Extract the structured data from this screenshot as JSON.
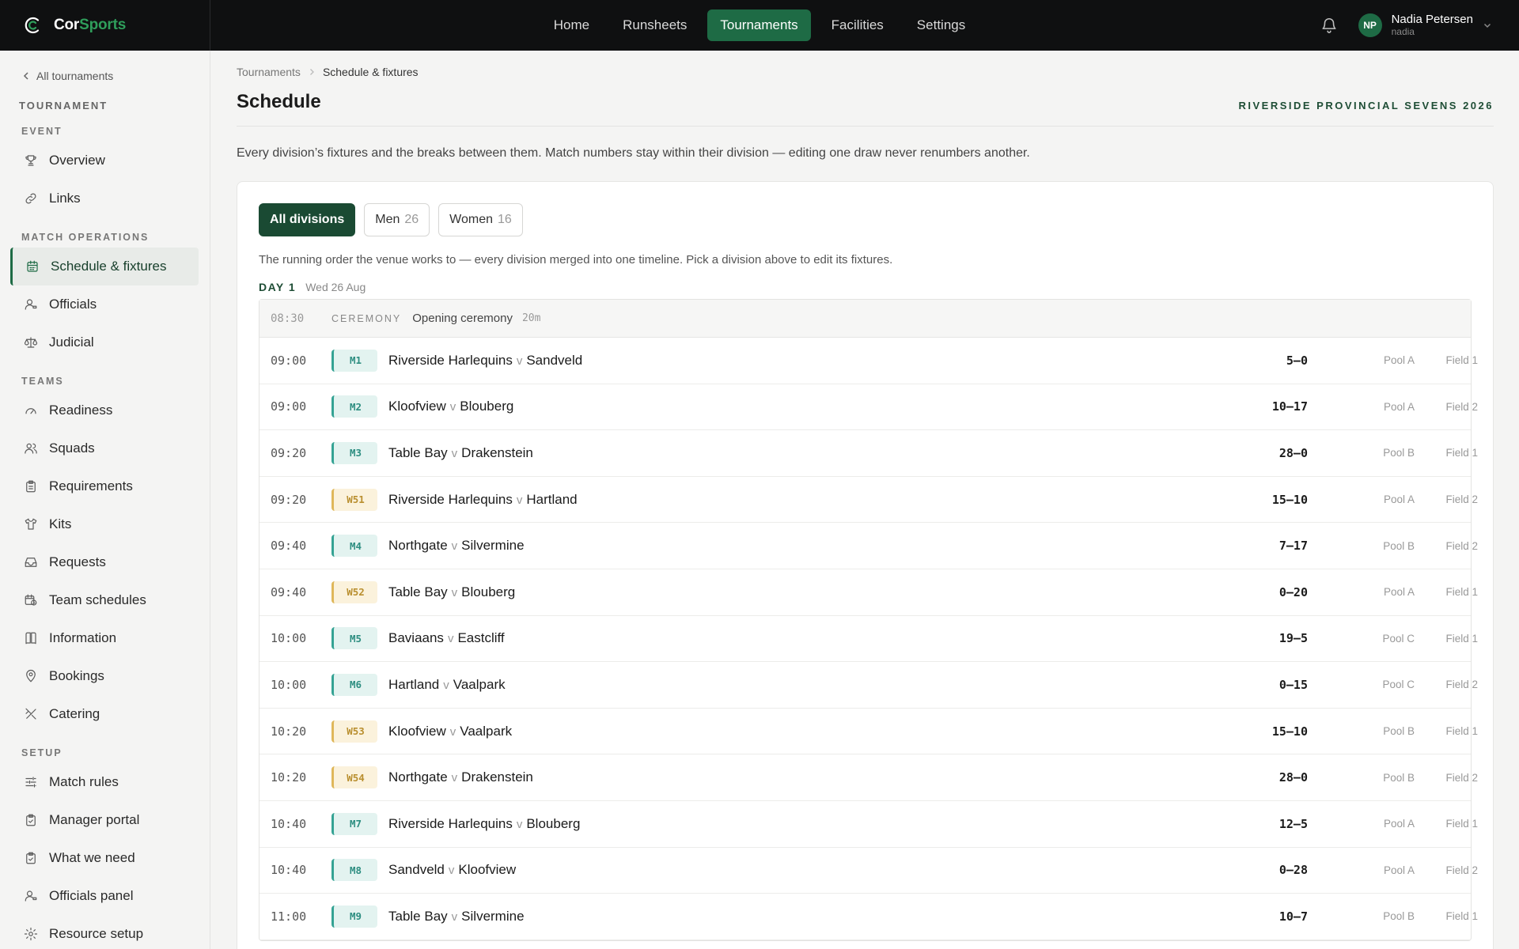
{
  "brand": {
    "name_a": "Cor",
    "name_b": "Sports",
    "accent": "#2f9e5b"
  },
  "nav": [
    {
      "label": "Home",
      "active": false
    },
    {
      "label": "Runsheets",
      "active": false
    },
    {
      "label": "Tournaments",
      "active": true
    },
    {
      "label": "Facilities",
      "active": false
    },
    {
      "label": "Settings",
      "active": false
    }
  ],
  "user": {
    "initials": "NP",
    "name": "Nadia Petersen",
    "handle": "nadia"
  },
  "sidebar": {
    "back_label": "All tournaments",
    "section_title": "TOURNAMENT",
    "groups": [
      {
        "title": "EVENT",
        "items": [
          {
            "label": "Overview",
            "icon": "trophy-icon"
          },
          {
            "label": "Links",
            "icon": "link-icon"
          }
        ]
      },
      {
        "title": "MATCH OPERATIONS",
        "items": [
          {
            "label": "Schedule & fixtures",
            "icon": "calendar-icon",
            "active": true
          },
          {
            "label": "Officials",
            "icon": "user-whistle-icon"
          },
          {
            "label": "Judicial",
            "icon": "scales-icon"
          }
        ]
      },
      {
        "title": "TEAMS",
        "items": [
          {
            "label": "Readiness",
            "icon": "gauge-icon"
          },
          {
            "label": "Squads",
            "icon": "users-icon"
          },
          {
            "label": "Requirements",
            "icon": "clipboard-icon"
          },
          {
            "label": "Kits",
            "icon": "shirt-icon"
          },
          {
            "label": "Requests",
            "icon": "inbox-icon"
          },
          {
            "label": "Team schedules",
            "icon": "calendar-clock-icon"
          },
          {
            "label": "Information",
            "icon": "book-icon"
          },
          {
            "label": "Bookings",
            "icon": "map-pin-icon"
          },
          {
            "label": "Catering",
            "icon": "utensils-icon"
          }
        ]
      },
      {
        "title": "SETUP",
        "items": [
          {
            "label": "Match rules",
            "icon": "sliders-icon"
          },
          {
            "label": "Manager portal",
            "icon": "clipboard-check-icon"
          },
          {
            "label": "What we need",
            "icon": "clipboard-check-icon"
          },
          {
            "label": "Officials panel",
            "icon": "user-whistle-icon"
          },
          {
            "label": "Resource setup",
            "icon": "settings-icon"
          }
        ]
      }
    ]
  },
  "breadcrumb": [
    "Tournaments",
    "Schedule & fixtures"
  ],
  "page": {
    "title": "Schedule",
    "tournament": "RIVERSIDE PROVINCIAL SEVENS 2026",
    "description": "Every division’s fixtures and the breaks between them. Match numbers stay within their division — editing one draw never renumbers another."
  },
  "filters": [
    {
      "label": "All divisions",
      "count": "",
      "active": true
    },
    {
      "label": "Men",
      "count": "26",
      "active": false
    },
    {
      "label": "Women",
      "count": "16",
      "active": false
    }
  ],
  "note": "The running order the venue works to — every division merged into one timeline. Pick a division above to edit its fixtures.",
  "day": {
    "label": "DAY 1",
    "date": "Wed 26 Aug"
  },
  "ceremony": {
    "time": "08:30",
    "kind": "CEREMONY",
    "label": "Opening ceremony",
    "duration": "20m"
  },
  "separator": "v",
  "fixtures": [
    {
      "time": "09:00",
      "code": "M1",
      "division": "men",
      "home": "Riverside Harlequins",
      "away": "Sandveld",
      "score": "5–0",
      "pool": "Pool A",
      "field": "Field 1"
    },
    {
      "time": "09:00",
      "code": "M2",
      "division": "men",
      "home": "Kloofview",
      "away": "Blouberg",
      "score": "10–17",
      "pool": "Pool A",
      "field": "Field 2"
    },
    {
      "time": "09:20",
      "code": "M3",
      "division": "men",
      "home": "Table Bay",
      "away": "Drakenstein",
      "score": "28–0",
      "pool": "Pool B",
      "field": "Field 1"
    },
    {
      "time": "09:20",
      "code": "W51",
      "division": "women",
      "home": "Riverside Harlequins",
      "away": "Hartland",
      "score": "15–10",
      "pool": "Pool A",
      "field": "Field 2"
    },
    {
      "time": "09:40",
      "code": "M4",
      "division": "men",
      "home": "Northgate",
      "away": "Silvermine",
      "score": "7–17",
      "pool": "Pool B",
      "field": "Field 2"
    },
    {
      "time": "09:40",
      "code": "W52",
      "division": "women",
      "home": "Table Bay",
      "away": "Blouberg",
      "score": "0–20",
      "pool": "Pool A",
      "field": "Field 1"
    },
    {
      "time": "10:00",
      "code": "M5",
      "division": "men",
      "home": "Baviaans",
      "away": "Eastcliff",
      "score": "19–5",
      "pool": "Pool C",
      "field": "Field 1"
    },
    {
      "time": "10:00",
      "code": "M6",
      "division": "men",
      "home": "Hartland",
      "away": "Vaalpark",
      "score": "0–15",
      "pool": "Pool C",
      "field": "Field 2"
    },
    {
      "time": "10:20",
      "code": "W53",
      "division": "women",
      "home": "Kloofview",
      "away": "Vaalpark",
      "score": "15–10",
      "pool": "Pool B",
      "field": "Field 1"
    },
    {
      "time": "10:20",
      "code": "W54",
      "division": "women",
      "home": "Northgate",
      "away": "Drakenstein",
      "score": "28–0",
      "pool": "Pool B",
      "field": "Field 2"
    },
    {
      "time": "10:40",
      "code": "M7",
      "division": "men",
      "home": "Riverside Harlequins",
      "away": "Blouberg",
      "score": "12–5",
      "pool": "Pool A",
      "field": "Field 1"
    },
    {
      "time": "10:40",
      "code": "M8",
      "division": "men",
      "home": "Sandveld",
      "away": "Kloofview",
      "score": "0–28",
      "pool": "Pool A",
      "field": "Field 2"
    },
    {
      "time": "11:00",
      "code": "M9",
      "division": "men",
      "home": "Table Bay",
      "away": "Silvermine",
      "score": "10–7",
      "pool": "Pool B",
      "field": "Field 1"
    }
  ]
}
